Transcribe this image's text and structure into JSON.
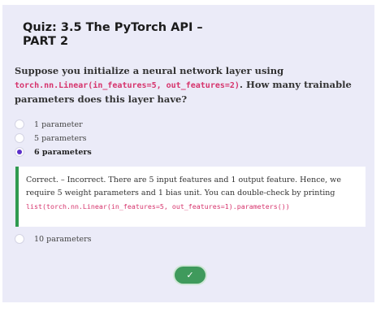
{
  "quiz": {
    "title": "Quiz: 3.5 The PyTorch API – PART 2"
  },
  "question": {
    "text_before": "Suppose you initialize a neural network layer using ",
    "code": "torch.nn.Linear(in_features=5, out_features=2)",
    "text_after": ". How many trainable parameters does this layer have?"
  },
  "options": [
    {
      "label": "1 parameter",
      "selected": false
    },
    {
      "label": "5 parameters",
      "selected": false
    },
    {
      "label": "6 parameters",
      "selected": true
    },
    {
      "label": "10 parameters",
      "selected": false
    }
  ],
  "feedback": {
    "text": "Correct. – Incorrect. There are 5 input features and 1 output feature. Hence, we require 5 weight parameters and 1 bias unit. You can double-check by printing ",
    "code": "list(torch.nn.Linear(in_features=5, out_features=1).parameters())"
  },
  "check_button": {
    "icon": "checkmark-icon",
    "glyph": "✓"
  },
  "colors": {
    "panel_background": "#ebebf8",
    "code_text": "#d6336c",
    "radio_selected": "#5b2fc9",
    "feedback_border": "#2f9a4f",
    "check_button": "#3f9a5c"
  }
}
